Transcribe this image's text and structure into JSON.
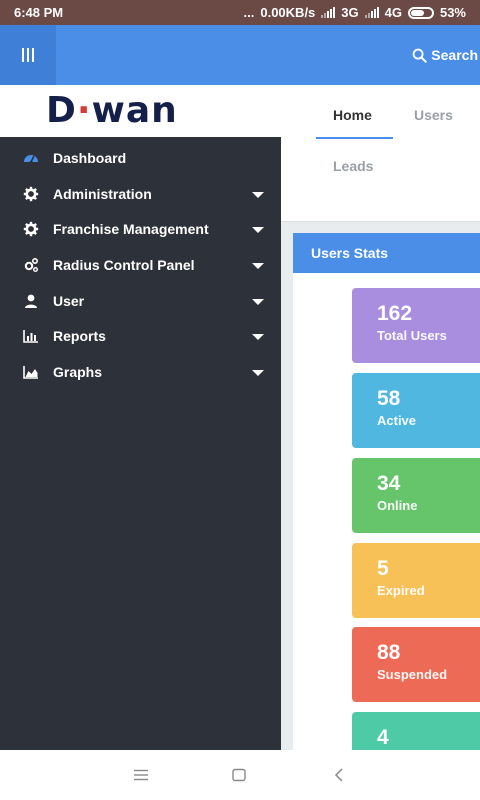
{
  "status_bar": {
    "time": "6:48 PM",
    "dots": "...",
    "speed": "0.00KB/s",
    "net1": "3G",
    "net2": "4G",
    "battery": "53%"
  },
  "topbar": {
    "search_label": "Search"
  },
  "logo": {
    "part1": "D",
    "part2": "·",
    "part3": "wan"
  },
  "tabs": [
    {
      "label": "Home",
      "active": true
    },
    {
      "label": "Users",
      "active": false
    },
    {
      "label": "Leads",
      "active": false
    }
  ],
  "sidebar": {
    "items": [
      {
        "label": "Dashboard",
        "icon": "dashboard-icon",
        "has_caret": false,
        "active": true
      },
      {
        "label": "Administration",
        "icon": "gear-icon",
        "has_caret": true
      },
      {
        "label": "Franchise Management",
        "icon": "gear-icon",
        "has_caret": true
      },
      {
        "label": "Radius Control Panel",
        "icon": "gears-icon",
        "has_caret": true
      },
      {
        "label": "User",
        "icon": "user-icon",
        "has_caret": true
      },
      {
        "label": "Reports",
        "icon": "bar-chart-icon",
        "has_caret": true
      },
      {
        "label": "Graphs",
        "icon": "area-chart-icon",
        "has_caret": true
      }
    ]
  },
  "stats": {
    "header": "Users Stats",
    "cards": [
      {
        "value": "162",
        "label": "Total Users",
        "color": "#a98ee0"
      },
      {
        "value": "58",
        "label": "Active",
        "color": "#4fb7e0"
      },
      {
        "value": "34",
        "label": "Online",
        "color": "#66c56a"
      },
      {
        "value": "5",
        "label": "Expired",
        "color": "#f7c158"
      },
      {
        "value": "88",
        "label": "Suspended",
        "color": "#ed6a57"
      },
      {
        "value": "4",
        "label": "",
        "color": "#4fcaa6"
      }
    ]
  },
  "colors": {
    "accent": "#4a8ee8",
    "sidebar_bg": "#2d323a",
    "status_bar_bg": "#6b4a46"
  }
}
